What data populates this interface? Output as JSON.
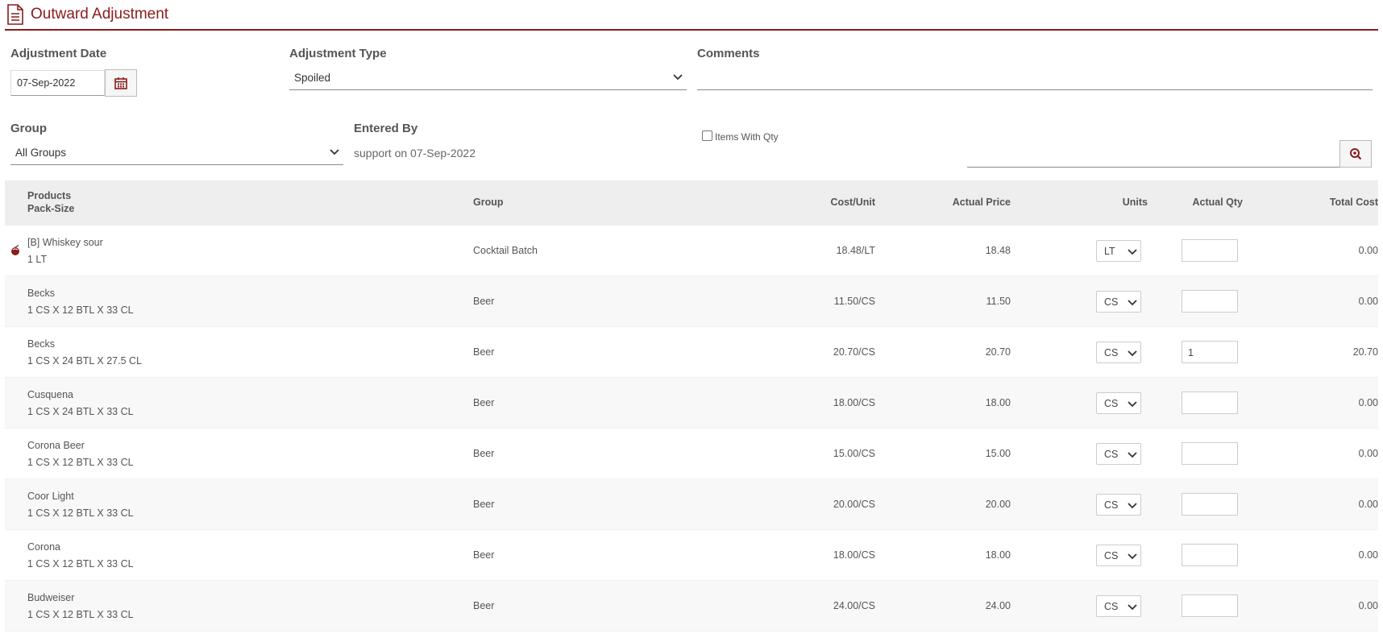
{
  "header": {
    "title": "Outward Adjustment",
    "icon": "document-icon"
  },
  "form": {
    "adjustment_date_label": "Adjustment Date",
    "adjustment_date_value": "07-Sep-2022",
    "adjustment_type_label": "Adjustment Type",
    "adjustment_type_value": "Spoiled",
    "comments_label": "Comments",
    "comments_value": "",
    "group_label": "Group",
    "group_value": "All Groups",
    "entered_by_label": "Entered By",
    "entered_by_value": "support on 07-Sep-2022",
    "items_with_qty_label": "Items With Qty",
    "items_with_qty_checked": false,
    "search_value": ""
  },
  "table": {
    "headers": {
      "products": "Products",
      "pack_size": "Pack-Size",
      "group": "Group",
      "cost_unit": "Cost/Unit",
      "actual_price": "Actual Price",
      "units": "Units",
      "actual_qty": "Actual Qty",
      "total_cost": "Total Cost"
    },
    "rows": [
      {
        "name": "[B] Whiskey sour",
        "pack": "1 LT",
        "group": "Cocktail Batch",
        "cost_unit": "18.48/LT",
        "price": "18.48",
        "unit": "LT",
        "qty": "",
        "total": "0.00",
        "icon": "cocktail-batch-icon"
      },
      {
        "name": "Becks",
        "pack": "1 CS X 12 BTL X 33 CL",
        "group": "Beer",
        "cost_unit": "11.50/CS",
        "price": "11.50",
        "unit": "CS",
        "qty": "",
        "total": "0.00"
      },
      {
        "name": "Becks",
        "pack": "1 CS X 24 BTL X 27.5 CL",
        "group": "Beer",
        "cost_unit": "20.70/CS",
        "price": "20.70",
        "unit": "CS",
        "qty": "1",
        "total": "20.70"
      },
      {
        "name": "Cusquena",
        "pack": "1 CS X 24 BTL X 33 CL",
        "group": "Beer",
        "cost_unit": "18.00/CS",
        "price": "18.00",
        "unit": "CS",
        "qty": "",
        "total": "0.00"
      },
      {
        "name": "Corona Beer",
        "pack": "1 CS X 12 BTL X 33 CL",
        "group": "Beer",
        "cost_unit": "15.00/CS",
        "price": "15.00",
        "unit": "CS",
        "qty": "",
        "total": "0.00"
      },
      {
        "name": "Coor Light",
        "pack": "1 CS X 12 BTL X 33 CL",
        "group": "Beer",
        "cost_unit": "20.00/CS",
        "price": "20.00",
        "unit": "CS",
        "qty": "",
        "total": "0.00"
      },
      {
        "name": "Corona",
        "pack": "1 CS X 12 BTL X 33 CL",
        "group": "Beer",
        "cost_unit": "18.00/CS",
        "price": "18.00",
        "unit": "CS",
        "qty": "",
        "total": "0.00"
      },
      {
        "name": "Budweiser",
        "pack": "1 CS X 12 BTL X 33 CL",
        "group": "Beer",
        "cost_unit": "24.00/CS",
        "price": "24.00",
        "unit": "CS",
        "qty": "",
        "total": "0.00"
      }
    ]
  },
  "colors": {
    "brand": "#8b1c1c",
    "header_bg": "#eeeeee",
    "alt_row": "#f8f8f8"
  }
}
